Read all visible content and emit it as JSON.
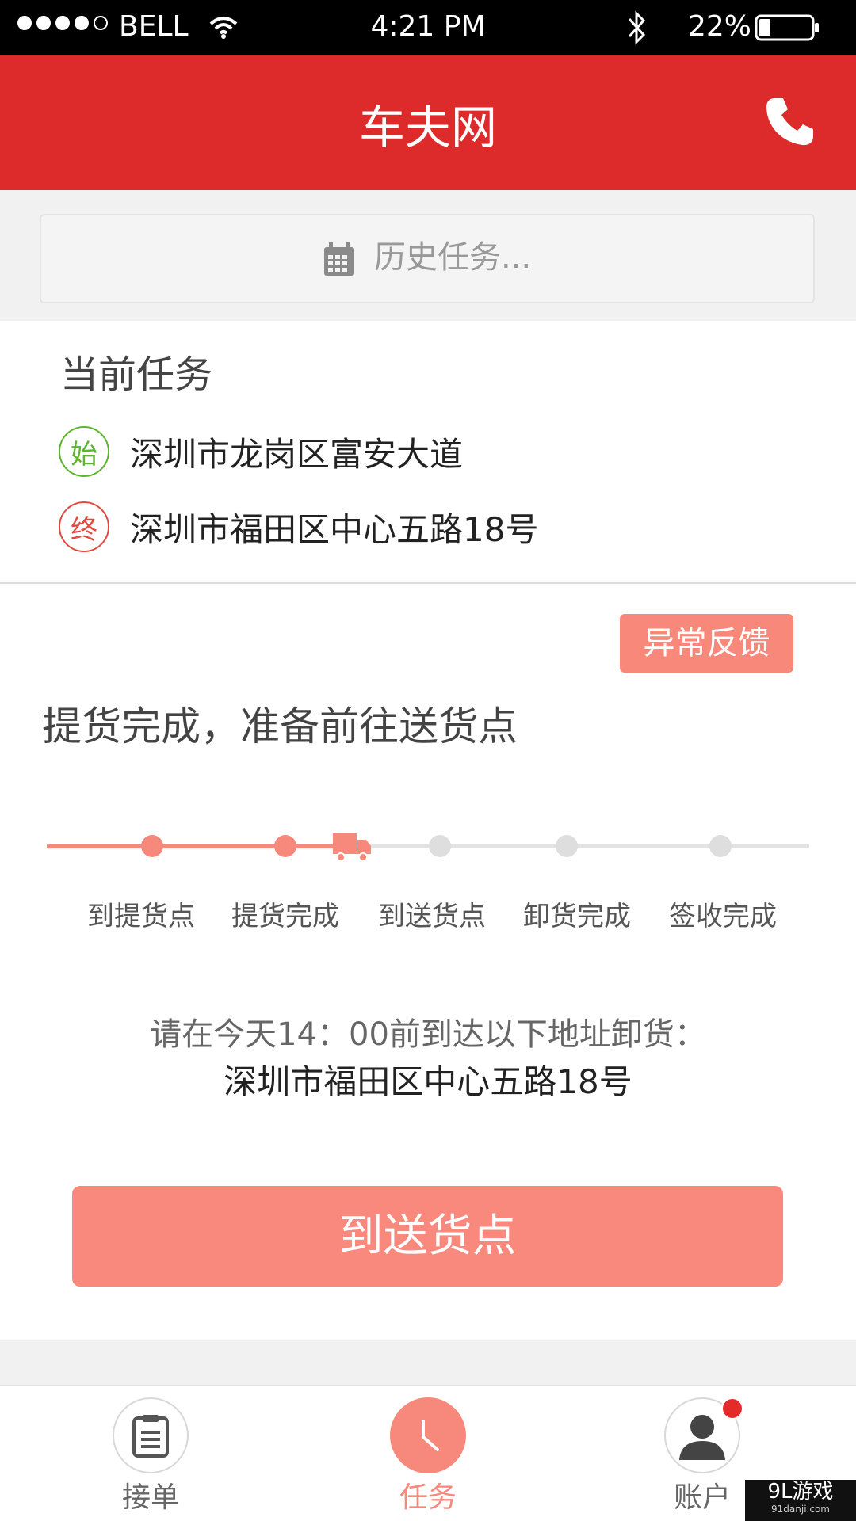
{
  "status_bar": {
    "carrier": "BELL",
    "time": "4:21 PM",
    "battery": "22%"
  },
  "header": {
    "title": "车夫网",
    "phone_icon": "phone-icon"
  },
  "search": {
    "placeholder": "历史任务...",
    "icon": "calendar-icon"
  },
  "current_task": {
    "heading": "当前任务",
    "start": {
      "badge": "始",
      "address": "深圳市龙岗区富安大道",
      "color": "#5cb52c"
    },
    "end": {
      "badge": "终",
      "address": "深圳市福田区中心五路18号",
      "color": "#e24a3f"
    }
  },
  "progress": {
    "feedback_button": "异常反馈",
    "status_title": "提货完成，准备前往送货点",
    "steps": [
      "到提货点",
      "提货完成",
      "到送货点",
      "卸货完成",
      "签收完成"
    ],
    "completed_steps": 2,
    "accent_color": "#f6897b"
  },
  "notice": {
    "line": "请在今天14：00前到达以下地址卸货：",
    "address": "深圳市福田区中心五路18号"
  },
  "action_button": "到送货点",
  "tabs": [
    {
      "label": "接单",
      "icon": "clipboard-icon",
      "active": false
    },
    {
      "label": "任务",
      "icon": "clock-icon",
      "active": true
    },
    {
      "label": "账户",
      "icon": "user-icon",
      "active": false,
      "has_badge": true
    }
  ],
  "watermark": {
    "main": "9L游戏",
    "sub": "91danji.com"
  }
}
